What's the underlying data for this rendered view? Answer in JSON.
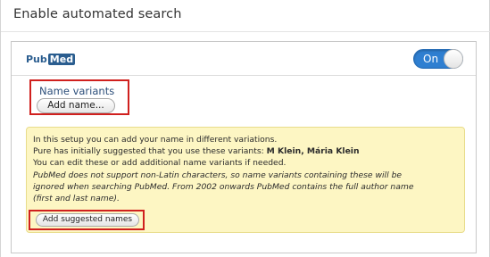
{
  "section": {
    "title": "Enable automated search"
  },
  "panel": {
    "logo": {
      "part1": "Pub",
      "part2": "Med"
    },
    "toggle": {
      "label": "On",
      "state": "on",
      "color": "#2f7fd1"
    },
    "name_variants": {
      "label": "Name variants",
      "add_button": "Add name..."
    },
    "notice": {
      "line1": "In this setup you can add your name in different variations.",
      "line2_prefix": "Pure has initially suggested that you use these variants: ",
      "line2_names": "M Klein, Mária Klein",
      "line3": "You can edit these or add additional name variants if needed.",
      "italic_line1": "PubMed does not support non-Latin characters, so name variants containing these will be",
      "italic_line2": "ignored when searching PubMed. From 2002 onwards PubMed contains the full author name",
      "italic_line3": "(first and last name).",
      "button": "Add suggested names",
      "background": "#fdf6c3"
    },
    "highlight_color": "#d0201e"
  }
}
